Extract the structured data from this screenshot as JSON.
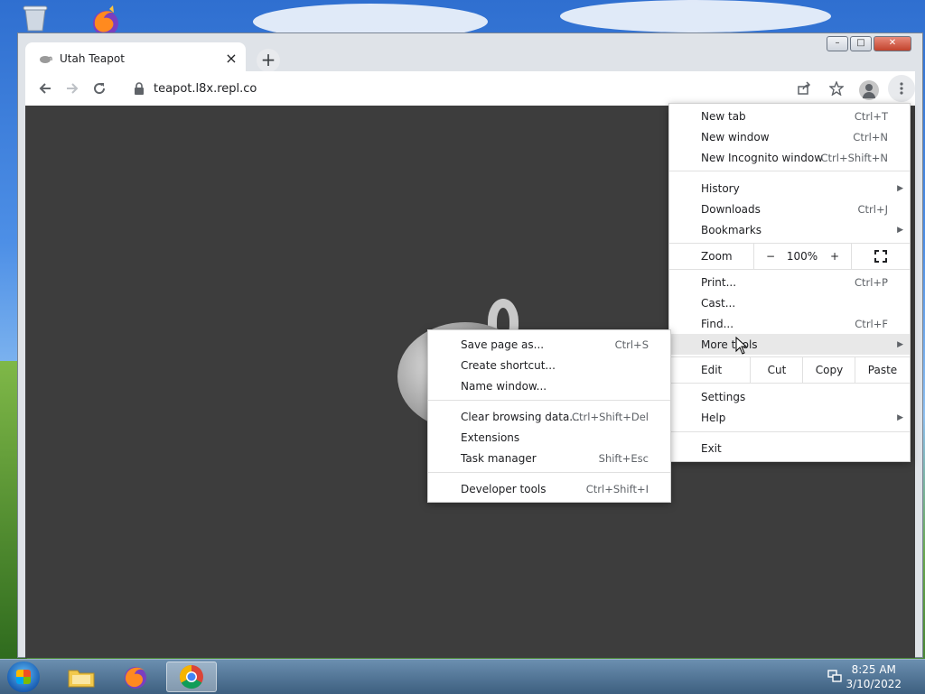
{
  "desktop": {
    "icons": [
      "recycle-bin-icon",
      "firefox-icon"
    ]
  },
  "browser": {
    "tab": {
      "title": "Utah Teapot",
      "favicon": "teapot-icon"
    },
    "url": "teapot.l8x.repl.co",
    "window_buttons": [
      "minimize",
      "maximize",
      "close"
    ]
  },
  "main_menu": {
    "items": [
      {
        "label": "New tab",
        "shortcut": "Ctrl+T"
      },
      {
        "label": "New window",
        "shortcut": "Ctrl+N"
      },
      {
        "label": "New Incognito window",
        "shortcut": "Ctrl+Shift+N"
      },
      {
        "label": "History",
        "submenu": true
      },
      {
        "label": "Downloads",
        "shortcut": "Ctrl+J"
      },
      {
        "label": "Bookmarks",
        "submenu": true
      },
      {
        "label": "Print...",
        "shortcut": "Ctrl+P"
      },
      {
        "label": "Cast..."
      },
      {
        "label": "Find...",
        "shortcut": "Ctrl+F"
      },
      {
        "label": "More tools",
        "submenu": true,
        "highlighted": true
      },
      {
        "label": "Settings"
      },
      {
        "label": "Help",
        "submenu": true
      },
      {
        "label": "Exit"
      }
    ],
    "zoom": {
      "label": "Zoom",
      "minus": "−",
      "value": "100%",
      "plus": "+"
    },
    "edit": {
      "label": "Edit",
      "cut": "Cut",
      "copy": "Copy",
      "paste": "Paste"
    }
  },
  "more_tools_menu": {
    "items": [
      {
        "label": "Save page as...",
        "shortcut": "Ctrl+S"
      },
      {
        "label": "Create shortcut..."
      },
      {
        "label": "Name window..."
      },
      {
        "label": "Clear browsing data...",
        "shortcut": "Ctrl+Shift+Del"
      },
      {
        "label": "Extensions"
      },
      {
        "label": "Task manager",
        "shortcut": "Shift+Esc"
      },
      {
        "label": "Developer tools",
        "shortcut": "Ctrl+Shift+I"
      }
    ]
  },
  "taskbar": {
    "time": "8:25 AM",
    "date": "3/10/2022",
    "apps": [
      "file-explorer-icon",
      "firefox-icon",
      "chrome-icon"
    ],
    "active_app": "chrome-icon"
  }
}
